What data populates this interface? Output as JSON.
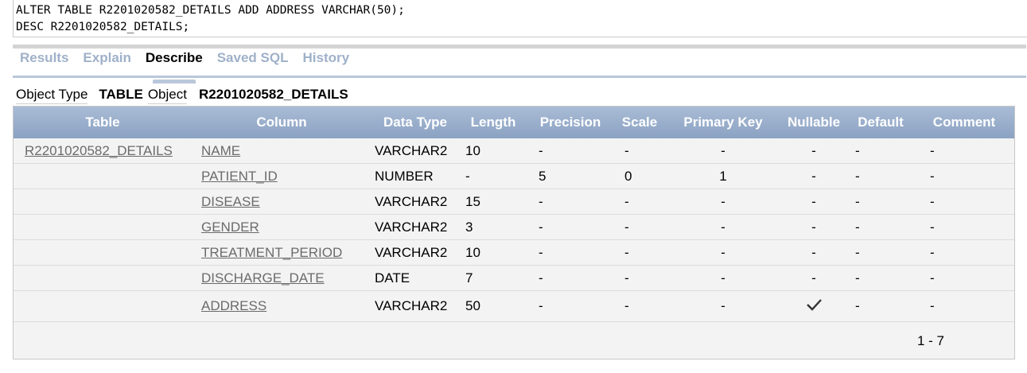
{
  "editor": {
    "lines": [
      "ALTER TABLE R2201020582_DETAILS ADD ADDRESS VARCHAR(50);",
      "DESC R2201020582_DETAILS;"
    ]
  },
  "tabs": [
    {
      "label": "Results",
      "active": false
    },
    {
      "label": "Explain",
      "active": false
    },
    {
      "label": "Describe",
      "active": true
    },
    {
      "label": "Saved SQL",
      "active": false
    },
    {
      "label": "History",
      "active": false
    }
  ],
  "object_info": {
    "type_label": "Object Type",
    "type_value": "TABLE",
    "object_label": "Object",
    "object_value": "R2201020582_DETAILS"
  },
  "table": {
    "headers": [
      "Table",
      "Column",
      "Data Type",
      "Length",
      "Precision",
      "Scale",
      "Primary Key",
      "Nullable",
      "Default",
      "Comment"
    ],
    "rows": [
      {
        "table": "R2201020582_DETAILS",
        "column": "NAME",
        "data_type": "VARCHAR2",
        "length": "10",
        "precision": "-",
        "scale": "-",
        "primary_key": "-",
        "nullable": "-",
        "default": "-",
        "comment": "-"
      },
      {
        "table": "",
        "column": "PATIENT_ID",
        "data_type": "NUMBER",
        "length": "-",
        "precision": "5",
        "scale": "0",
        "primary_key": "1",
        "nullable": "-",
        "default": "-",
        "comment": "-"
      },
      {
        "table": "",
        "column": "DISEASE",
        "data_type": "VARCHAR2",
        "length": "15",
        "precision": "-",
        "scale": "-",
        "primary_key": "-",
        "nullable": "-",
        "default": "-",
        "comment": "-"
      },
      {
        "table": "",
        "column": "GENDER",
        "data_type": "VARCHAR2",
        "length": "3",
        "precision": "-",
        "scale": "-",
        "primary_key": "-",
        "nullable": "-",
        "default": "-",
        "comment": "-"
      },
      {
        "table": "",
        "column": "TREATMENT_PERIOD",
        "data_type": "VARCHAR2",
        "length": "10",
        "precision": "-",
        "scale": "-",
        "primary_key": "-",
        "nullable": "-",
        "default": "-",
        "comment": "-"
      },
      {
        "table": "",
        "column": "DISCHARGE_DATE",
        "data_type": "DATE",
        "length": "7",
        "precision": "-",
        "scale": "-",
        "primary_key": "-",
        "nullable": "-",
        "default": "-",
        "comment": "-"
      },
      {
        "table": "",
        "column": "ADDRESS",
        "data_type": "VARCHAR2",
        "length": "50",
        "precision": "-",
        "scale": "-",
        "primary_key": "-",
        "nullable": "check-icon",
        "default": "-",
        "comment": "-"
      }
    ],
    "pagination": "1 - 7"
  },
  "colors": {
    "header_bg": "#9cb0cc",
    "tab_inactive": "#9fb1c9",
    "link": "#6b6b6b"
  }
}
